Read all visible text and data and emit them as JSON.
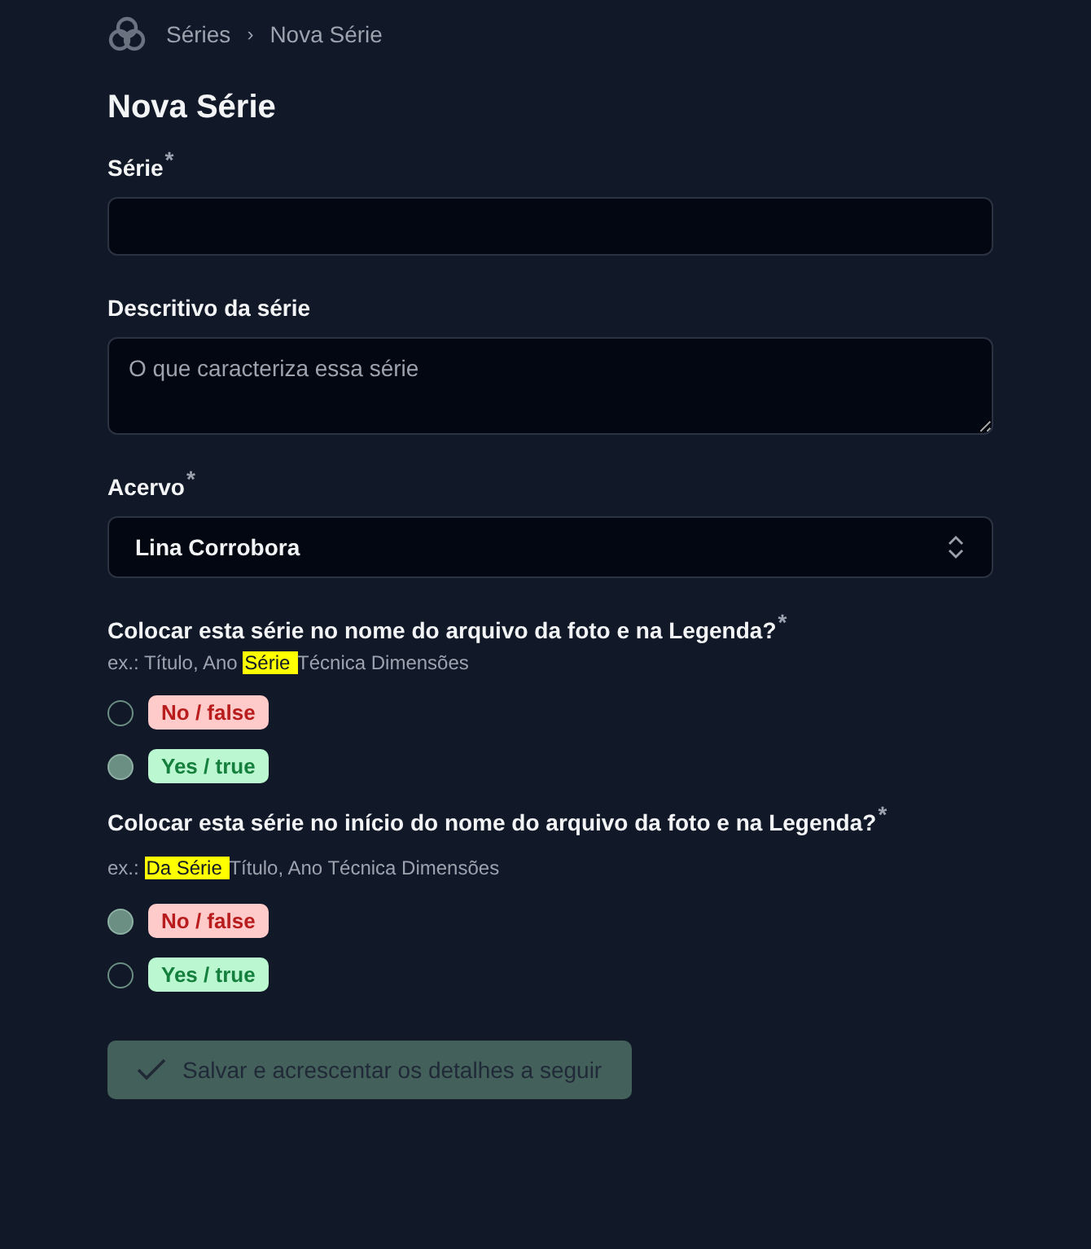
{
  "breadcrumb": {
    "items": [
      "Séries",
      "Nova Série"
    ],
    "separator": "›"
  },
  "title": "Nova Série",
  "fields": [
    {
      "kind": "input",
      "label": "Série",
      "required_mark": "*"
    },
    {
      "kind": "textarea",
      "label": "Descritivo da série",
      "placeholder": "O que caracteriza essa série"
    },
    {
      "kind": "select",
      "label": "Acervo",
      "required_mark": "*",
      "value": "Lina Corrobora"
    }
  ],
  "questions": [
    {
      "label": "Colocar esta série no nome do arquivo da foto e na Legenda?",
      "required_mark": "*",
      "hint": {
        "prefix": "ex.: Título, Ano ",
        "highlight": "Série ",
        "suffix": "Técnica Dimensões"
      },
      "options": [
        {
          "label": "No / false",
          "kind": "negative",
          "selected": false
        },
        {
          "label": "Yes / true",
          "kind": "positive",
          "selected": true
        }
      ]
    },
    {
      "label": "Colocar esta série no início do nome do arquivo da foto e na Legenda?",
      "required_mark": "*",
      "hint": {
        "prefix": "ex.: ",
        "highlight": "Da Série ",
        "suffix": "Título, Ano Técnica Dimensões"
      },
      "options": [
        {
          "label": "No / false",
          "kind": "negative",
          "selected": true
        },
        {
          "label": "Yes / true",
          "kind": "positive",
          "selected": false
        }
      ]
    }
  ],
  "submit": {
    "label": "Salvar e acrescentar os detalhes a seguir",
    "disabled": true
  }
}
